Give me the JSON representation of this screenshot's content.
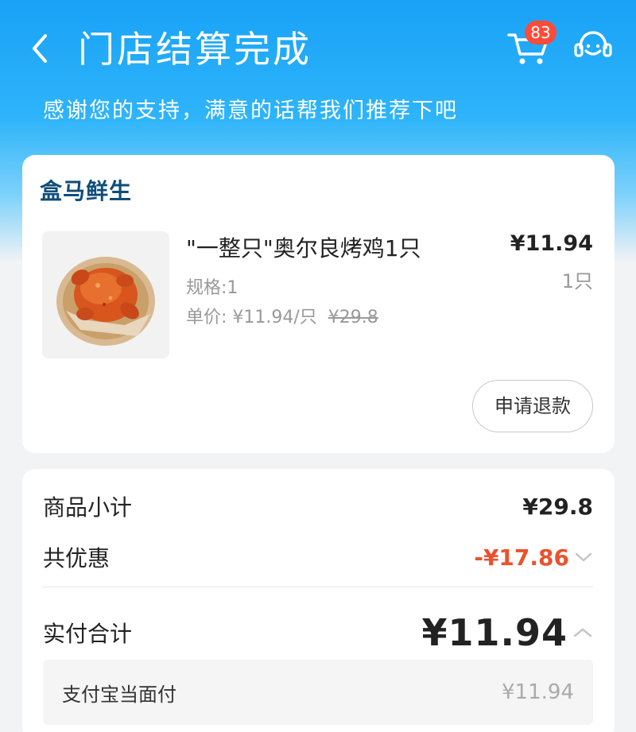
{
  "header": {
    "title": "门店结算完成",
    "subtitle": "感谢您的支持，满意的话帮我们推荐下吧",
    "cart_badge": "83",
    "icons": [
      "back-arrow-icon",
      "cart-icon",
      "customer-service-icon"
    ],
    "colors": {
      "header_blue": "#19a2f7",
      "accent_red": "#e9522f",
      "badge_red": "#ff4b3a"
    }
  },
  "order": {
    "store_name": "盒马鲜生",
    "product": {
      "name": "\"一整只\"奥尔良烤鸡1只",
      "price": "¥11.94",
      "quantity": "1只",
      "spec": "规格:1",
      "unit_price": "单价: ¥11.94/只",
      "original_price": "¥29.8",
      "image": "roast-chicken-image"
    },
    "refund_label": "申请退款"
  },
  "summary": {
    "subtotal_label": "商品小计",
    "subtotal_value": "¥29.8",
    "discount_label": "共优惠",
    "discount_value": "-¥17.86",
    "total_label": "实付合计",
    "total_value": "¥11.94",
    "payment_method": "支付宝当面付",
    "payment_amount": "¥11.94"
  }
}
